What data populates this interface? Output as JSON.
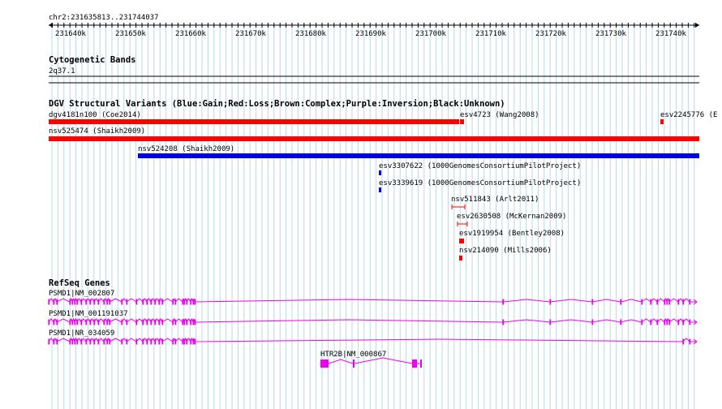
{
  "ruler": {
    "range_label": "chr2:231635813..231744037",
    "ticks": [
      "231640k",
      "231650k",
      "231660k",
      "231670k",
      "231680k",
      "231690k",
      "231700k",
      "231710k",
      "231720k",
      "231730k",
      "231740k"
    ]
  },
  "tracks": {
    "cytoband": {
      "title": "Cytogenetic Bands",
      "band_label": "2q37.1"
    },
    "dgv": {
      "title": "DGV Structural Variants (Blue:Gain;Red:Loss;Brown:Complex;Purple:Inversion;Black:Unknown)",
      "features": [
        {
          "label": "dgv4181n100 (Coe2014)",
          "type": "loss"
        },
        {
          "label": "esv4723 (Wang2008)",
          "type": "loss"
        },
        {
          "label": "esv2245776 (E",
          "type": "loss"
        },
        {
          "label": "nsv525474 (Shaikh2009)",
          "type": "loss"
        },
        {
          "label": "nsv524208 (Shaikh2009)",
          "type": "gain"
        },
        {
          "label": "esv3307622 (1000GenomesConsortiumPilotProject)",
          "type": "gain"
        },
        {
          "label": "esv3339619 (1000GenomesConsortiumPilotProject)",
          "type": "gain"
        },
        {
          "label": "nsv511843 (Arlt2011)",
          "type": "loss"
        },
        {
          "label": "esv2630508 (McKernan2009)",
          "type": "loss"
        },
        {
          "label": "esv1919954 (Bentley2008)",
          "type": "loss"
        },
        {
          "label": "nsv214090 (Mills2006)",
          "type": "loss"
        }
      ]
    },
    "refseq": {
      "title": "RefSeq Genes",
      "transcripts": [
        {
          "label": "PSMD1|NM_002807"
        },
        {
          "label": "PSMD1|NM_001191037"
        },
        {
          "label": "PSMD1|NR_034059"
        },
        {
          "label": "HTR2B|NM_000867"
        }
      ]
    }
  },
  "colors": {
    "loss": "#ff0000",
    "gain": "#0000ee",
    "gene": "#ee00ee",
    "grid": "#b8d8e8"
  }
}
